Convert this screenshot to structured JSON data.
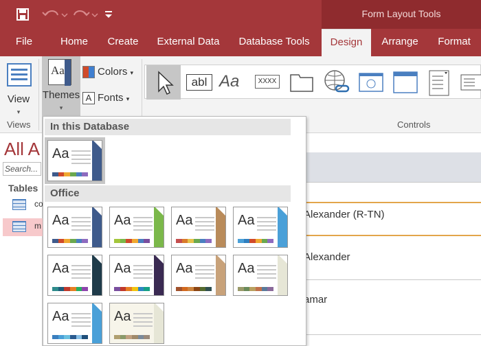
{
  "quick_access": {
    "save": "save-icon",
    "undo": "undo-icon",
    "redo": "redo-icon",
    "more": "customize-icon"
  },
  "context_header": "Form Layout Tools",
  "tabs": [
    {
      "label": "File"
    },
    {
      "label": "Home"
    },
    {
      "label": "Create"
    },
    {
      "label": "External Data"
    },
    {
      "label": "Database Tools"
    },
    {
      "label": "Design",
      "active": true
    },
    {
      "label": "Arrange"
    },
    {
      "label": "Format"
    }
  ],
  "ribbon": {
    "views_label": "Views",
    "view_button": "View",
    "themes_button": "Themes",
    "colors_button": "Colors",
    "fonts_button": "Fonts",
    "controls_label": "Controls",
    "themes_icon_text": "Aa",
    "fonts_icon_text": "A",
    "text_box_icon_text": "abl",
    "label_icon_text": "Aa",
    "button_icon_text": "XXXX",
    "controls": [
      "select-pointer-icon",
      "text-box-icon",
      "label-icon",
      "button-icon",
      "tab-control-icon",
      "hyperlink-icon",
      "web-browser-icon",
      "navigation-control-icon",
      "combo-box-icon",
      "list-box-icon"
    ]
  },
  "nav_pane": {
    "title": "All A",
    "search_placeholder": "Search...",
    "section": "Tables",
    "items": [
      {
        "label": "co"
      },
      {
        "label": "m",
        "selected": true
      }
    ]
  },
  "form": {
    "rows": [
      "Alexander (R-TN)",
      "Alexander",
      "amar"
    ]
  },
  "themes_dropdown": {
    "section_db": "In this Database",
    "section_office": "Office",
    "thumb_text": "Aa",
    "themes": [
      {
        "accent": "#3f5b8c",
        "bg": "#ffffff",
        "swatches": [
          "#3f5b8c",
          "#d04a2a",
          "#f0a830",
          "#6aa84f",
          "#4a7fc0",
          "#8e6bbf"
        ]
      },
      {
        "accent": "#3f5b8c",
        "bg": "#ffffff",
        "swatches": [
          "#3f5b8c",
          "#d04a2a",
          "#f0a830",
          "#6aa84f",
          "#4a7fc0",
          "#8e6bbf"
        ]
      },
      {
        "accent": "#7bb84a",
        "bg": "#ffffff",
        "swatches": [
          "#a3c63c",
          "#7bb84a",
          "#d04a2a",
          "#f0a830",
          "#4a7fc0",
          "#7a4e9e"
        ]
      },
      {
        "accent": "#b98b5a",
        "bg": "#ffffff",
        "swatches": [
          "#c44e4e",
          "#d97b2b",
          "#e5c24a",
          "#6aa84f",
          "#4a7fc0",
          "#8e6bbf"
        ]
      },
      {
        "accent": "#4aa0d8",
        "bg": "#ffffff",
        "swatches": [
          "#4aa0d8",
          "#2f7fbf",
          "#d04a2a",
          "#f0a830",
          "#6aa84f",
          "#8e6bbf"
        ]
      },
      {
        "accent": "#1f3b4a",
        "bg": "#ffffff",
        "swatches": [
          "#2e8b8b",
          "#1f5c7a",
          "#c0392b",
          "#e67e22",
          "#27ae60",
          "#8e44ad"
        ]
      },
      {
        "accent": "#3a2a52",
        "bg": "#ffffff",
        "swatches": [
          "#7a4e9e",
          "#c0392b",
          "#e67e22",
          "#f1c40f",
          "#2e86c1",
          "#16a085"
        ]
      },
      {
        "accent": "#c8a27a",
        "bg": "#ffffff",
        "swatches": [
          "#a0522d",
          "#d2691e",
          "#cd853f",
          "#8b4513",
          "#556b2f",
          "#2f4f4f"
        ]
      },
      {
        "accent": "#e6e6d6",
        "bg": "#ffffff",
        "swatches": [
          "#9a9a6a",
          "#6a8a5a",
          "#b8a060",
          "#c0704a",
          "#5a7a9a",
          "#8a6a9a"
        ]
      },
      {
        "accent": "#4aa0d8",
        "bg": "#ffffff",
        "swatches": [
          "#3a7fbf",
          "#4aa0d8",
          "#6ac0e0",
          "#2a5a8f",
          "#88bfe6",
          "#1f4f7a"
        ]
      },
      {
        "accent": "#e6e6d6",
        "bg": "#f7f5ea",
        "swatches": [
          "#b0a070",
          "#8a9a6a",
          "#c0a080",
          "#a08a6a",
          "#7a8a9a",
          "#9a8a7a"
        ]
      }
    ]
  },
  "colors": {
    "titlebar": "#a4373a",
    "context": "#8f2b2e",
    "ribbon": "#f3f3f3"
  }
}
